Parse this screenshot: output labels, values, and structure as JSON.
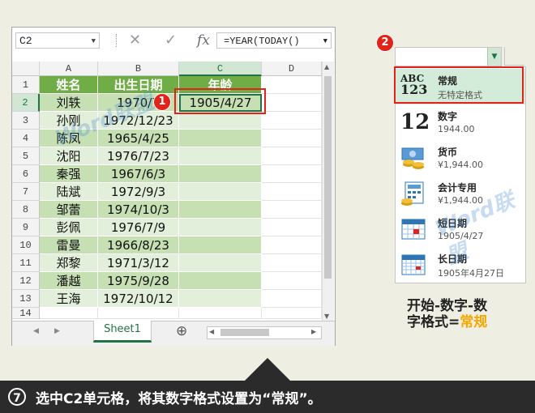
{
  "formula_bar": {
    "name_box": "C2",
    "cancel_icon": "✕",
    "confirm_icon": "✓",
    "fx_label": "fx",
    "formula": "=YEAR(TODAY()"
  },
  "grid": {
    "columns": [
      "A",
      "B",
      "C",
      "D"
    ],
    "rows": [
      "1",
      "2",
      "3",
      "4",
      "5",
      "6",
      "7",
      "8",
      "9",
      "10",
      "11",
      "12",
      "13",
      "14"
    ],
    "header": {
      "name": "姓名",
      "birth": "出生日期",
      "age": "年龄"
    },
    "data": [
      {
        "name": "刘轶",
        "birth": "1970/7",
        "age": "1905/4/27"
      },
      {
        "name": "孙刚",
        "birth": "1972/12/23",
        "age": ""
      },
      {
        "name": "陈凤",
        "birth": "1965/4/25",
        "age": ""
      },
      {
        "name": "沈阳",
        "birth": "1976/7/23",
        "age": ""
      },
      {
        "name": "秦强",
        "birth": "1967/6/3",
        "age": ""
      },
      {
        "name": "陆斌",
        "birth": "1972/9/3",
        "age": ""
      },
      {
        "name": "邹蕾",
        "birth": "1974/10/3",
        "age": ""
      },
      {
        "name": "彭佩",
        "birth": "1976/7/9",
        "age": ""
      },
      {
        "name": "雷曼",
        "birth": "1966/8/23",
        "age": ""
      },
      {
        "name": "郑黎",
        "birth": "1971/3/12",
        "age": ""
      },
      {
        "name": "潘越",
        "birth": "1975/9/28",
        "age": ""
      },
      {
        "name": "王海",
        "birth": "1972/10/12",
        "age": ""
      }
    ]
  },
  "sheet_tab": "Sheet1",
  "nav": {
    "prev": "◀",
    "next": "▶",
    "add": "⊕",
    "scroll_left": "◀",
    "scroll_right": "▶",
    "up": "▲",
    "down": "▼"
  },
  "badges": {
    "one": "1",
    "two": "2"
  },
  "format_menu": {
    "items": [
      {
        "icon_text": "ABC\n123",
        "name": "常规",
        "value": "无特定格式"
      },
      {
        "icon_text": "12",
        "name": "数字",
        "value": "1944.00"
      },
      {
        "icon_text": "",
        "name": "货币",
        "value": "¥1,944.00"
      },
      {
        "icon_text": "",
        "name": "会计专用",
        "value": "¥1,944.00"
      },
      {
        "icon_text": "",
        "name": "短日期",
        "value": "1905/4/27"
      },
      {
        "icon_text": "",
        "name": "长日期",
        "value": "1905年4月27日"
      }
    ]
  },
  "callout": {
    "line1": "开始-数字-数",
    "line2a": "字格式=",
    "line2b": "常规"
  },
  "step": {
    "number": "7",
    "caption": "选中C2单元格，将其数字格式设置为“常规”。"
  },
  "watermark": "Word联盟",
  "colors": {
    "header_green": "#70ad47",
    "light_green": "#e2efda",
    "mid_green": "#c6e0b4",
    "red": "#e2231a",
    "excel_green": "#217346",
    "callout_orange": "#f7a600"
  }
}
